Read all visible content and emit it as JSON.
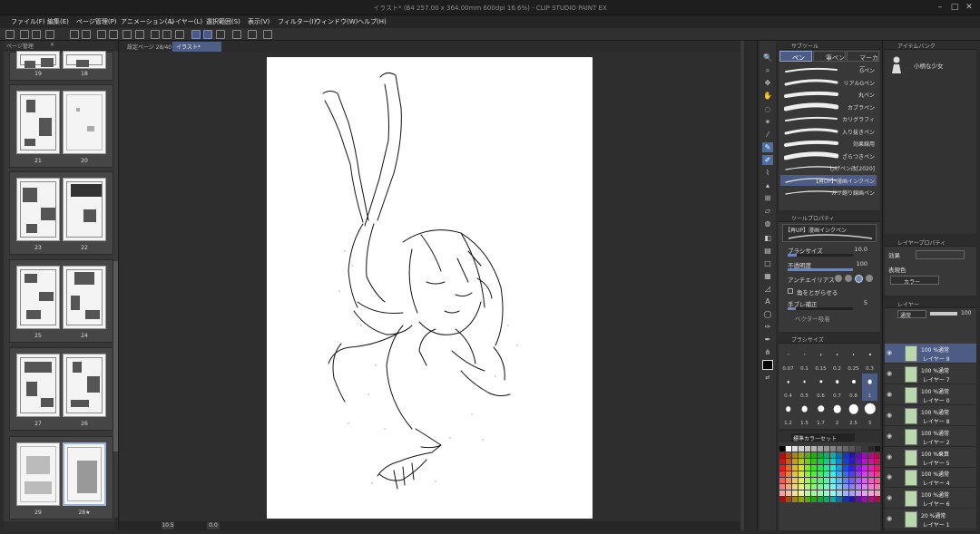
{
  "window": {
    "title": "イラスト* (B4 257.00 x 364.00mm 600dpi 16.6%) - CLIP STUDIO PAINT EX"
  },
  "menu": [
    "ファイル(F)",
    "編集(E)",
    "ページ管理(P)",
    "アニメーション(A)",
    "レイヤー(L)",
    "選択範囲(S)",
    "表示(V)",
    "フィルター(I)",
    "ウィンドウ(W)",
    "ヘルプ(H)"
  ],
  "page_panel": {
    "tab": "ページ管理",
    "spreads": [
      {
        "left": "19",
        "right": "18"
      },
      {
        "left": "21",
        "right": "20"
      },
      {
        "left": "23",
        "right": "22"
      },
      {
        "left": "25",
        "right": "24"
      },
      {
        "left": "27",
        "right": "26"
      },
      {
        "left": "29",
        "right": "28★"
      }
    ]
  },
  "doc_tabs": [
    "設定ページ 28/40",
    "イラスト*"
  ],
  "status": {
    "zoom": "10.5",
    "rotation": "0.0"
  },
  "sub_tool": {
    "header": "サブツール",
    "tabs": [
      "ペン",
      "筆ペン",
      "マーカー"
    ],
    "brushes": [
      "Gペン",
      "リアルGペン",
      "丸ペン",
      "カブラペン",
      "カリグラフィ",
      "入り抜きペン",
      "効果線用",
      "ざらつきペン",
      "しげペン改[2020]",
      "【再UP】漫画インクペン",
      "ガサ飽り線画ペン"
    ],
    "selected_index": 9
  },
  "tool_property": {
    "header": "ツールプロパティ",
    "brush_name": "【再UP】漫画インクペン",
    "brush_size_label": "ブラシサイズ",
    "brush_size": "10.0",
    "brush_size_fill": 0.14,
    "opacity_label": "不透明度",
    "opacity": "100",
    "opacity_fill": 1.0,
    "antialias_label": "アンチエイリアス",
    "stroke_label": "角をとがらせる",
    "stabilization_label": "手ブレ補正",
    "stabilization": "5",
    "stabilization_fill": 0.12,
    "vector_label": "ベクター吸着"
  },
  "brush_size_panel": {
    "header": "ブラシサイズ",
    "sizes": [
      "0.07",
      "0.1",
      "0.15",
      "0.2",
      "0.25",
      "0.3",
      "0.4",
      "0.5",
      "0.6",
      "0.7",
      "0.8",
      "1",
      "1.2",
      "1.5",
      "1.7",
      "2",
      "2.5",
      "3"
    ],
    "selected": "1"
  },
  "color_set": {
    "preset": "標準カラーセット",
    "colors": [
      "#000000",
      "#ffffff",
      "#ff0000",
      "#00a0e9",
      "#ffff00",
      "#00ff00",
      "#ff00ff",
      "#0000ff"
    ]
  },
  "navigator": {
    "tab": "アイテムバンク",
    "item": "小柄な少女"
  },
  "layer_property": {
    "header": "レイヤープロパティ",
    "effect_label": "効果",
    "expression_label": "表現色",
    "expression_value": "カラー"
  },
  "layers": {
    "header": "レイヤー",
    "blend": "通常",
    "opacity": "100",
    "items": [
      {
        "mode": "100 %通常",
        "name": "レイヤー 9"
      },
      {
        "mode": "100 %通常",
        "name": "レイヤー 7"
      },
      {
        "mode": "100 %通常",
        "name": "レイヤー 0"
      },
      {
        "mode": "100 %通常",
        "name": "レイヤー 8"
      },
      {
        "mode": "100 %通常",
        "name": "レイヤー 2"
      },
      {
        "mode": "100 %乗算",
        "name": "レイヤー 5"
      },
      {
        "mode": "100 %通常",
        "name": "レイヤー 4"
      },
      {
        "mode": "100 %通常",
        "name": "レイヤー 6"
      },
      {
        "mode": "20 %通常",
        "name": "レイヤー 1"
      }
    ]
  }
}
